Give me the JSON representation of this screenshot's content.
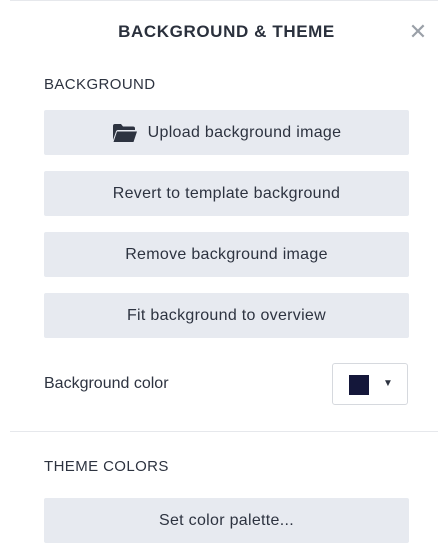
{
  "panel": {
    "title": "BACKGROUND & THEME",
    "close_glyph": "✕"
  },
  "background": {
    "heading": "BACKGROUND",
    "upload_label": "Upload background image",
    "upload_icon": "folder-open-icon",
    "revert_label": "Revert to template background",
    "remove_label": "Remove background image",
    "fit_label": "Fit background to overview",
    "color_label": "Background color",
    "color_value": "#14173a",
    "caret_glyph": "▼"
  },
  "theme": {
    "heading": "THEME COLORS",
    "palette_label": "Set color palette..."
  },
  "colors": {
    "button_bg": "#e7eaf0",
    "text": "#2d3340",
    "icon": "#2d3340"
  }
}
